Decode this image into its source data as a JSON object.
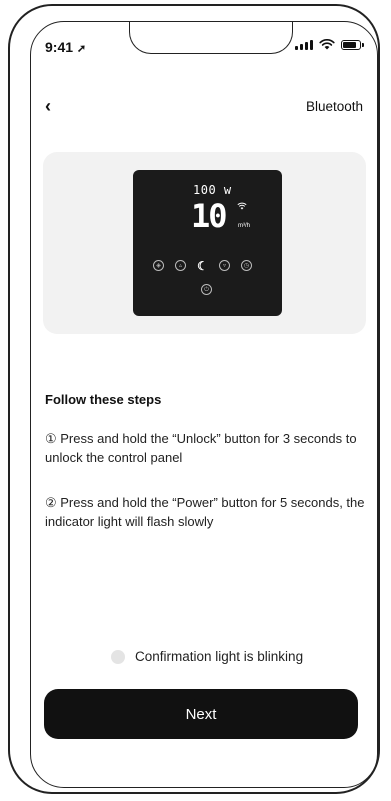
{
  "status_bar": {
    "time": "9:41"
  },
  "header": {
    "back_icon": "‹",
    "title": "Bluetooth"
  },
  "device_panel": {
    "power_display": "100 w",
    "main_value": "10",
    "unit": "m³/h"
  },
  "instructions": {
    "title": "Follow these steps",
    "steps": [
      "① Press and hold the “Unlock” button for 3 seconds to unlock the control panel",
      "② Press and hold the “Power” button for 5 seconds, the indicator light will flash slowly"
    ]
  },
  "confirm": {
    "label": "Confirmation light is blinking",
    "checked": false
  },
  "next_button": {
    "label": "Next"
  }
}
